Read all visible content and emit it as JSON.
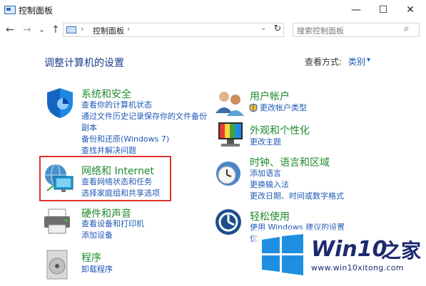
{
  "window": {
    "title": "控制面板",
    "minimize_label": "—",
    "maximize_label": "☐",
    "close_label": "✕"
  },
  "nav": {
    "back": "←",
    "forward": "→",
    "recent": "⌄",
    "up": "↑",
    "refresh": "↻",
    "address_sep": "›",
    "address_text": "控制面板",
    "address_dropdown": "⌄",
    "search_placeholder": "搜索控制面板",
    "search_icon": "⌕"
  },
  "main": {
    "title": "调整计算机的设置",
    "view_label": "查看方式:",
    "view_value": "类别",
    "view_dropdown": "▾"
  },
  "categories": [
    {
      "title": "系统和安全",
      "links": [
        "查看你的计算机状态",
        "通过文件历史记录保存你的文件备份",
        "副本",
        "备份和还原(Windows 7)",
        "查找并解决问题"
      ]
    },
    {
      "title": "网络和 Internet",
      "links": [
        "查看网络状态和任务",
        "选择家庭组和共享选项"
      ]
    },
    {
      "title": "硬件和声音",
      "links": [
        "查看设备和打印机",
        "添加设备"
      ]
    },
    {
      "title": "程序",
      "links": [
        "卸载程序"
      ]
    },
    {
      "title": "用户帐户",
      "links": [
        "更改帐户类型"
      ]
    },
    {
      "title": "外观和个性化",
      "links": [
        "更改主题"
      ]
    },
    {
      "title": "时钟、语言和区域",
      "links": [
        "添加语言",
        "更换输入法",
        "更改日期、时间或数字格式"
      ]
    },
    {
      "title": "轻松使用",
      "links": [
        "使用 Windows 建议的设置",
        "优"
      ]
    }
  ],
  "watermark": {
    "brand_prefix": "Win10",
    "brand_suffix": "之家",
    "url": "www.win10xitong.com"
  },
  "colors": {
    "category_title": "#1f8a2c",
    "link": "#1f58b8",
    "highlight": "#e23030",
    "brand": "#1d2a6f",
    "win_logo": "#1e8fe0"
  }
}
